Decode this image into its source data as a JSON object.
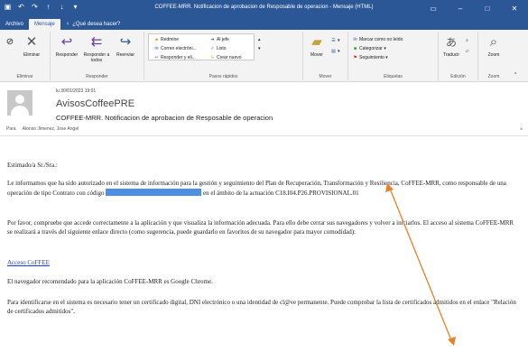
{
  "window": {
    "title": "COFFEE-MRR. Notificacion de aprobacion de Resposable de operacion - Mensaje (HTML)"
  },
  "tabs": [
    "Archivo",
    "Mensaje",
    "¿Qué desea hacer?"
  ],
  "ribbon": {
    "delete_group": {
      "ignore": "",
      "delete": "Eliminar",
      "label": "Eliminar"
    },
    "respond_group": {
      "reply": "Responder",
      "reply_all": "Responder a todos",
      "forward": "Reenviar",
      "label": "Responder"
    },
    "quicksteps_group": {
      "items": [
        "Redmine",
        "Correo electróni...",
        "Responder y eli...",
        "Al jefe",
        "Listo",
        "Crear nuevo"
      ],
      "label": "Pasos rápidos"
    },
    "move_group": {
      "move": "Mover",
      "label": "Mover"
    },
    "tags_group": {
      "mark_unread": "Marcar como no leído",
      "categorize": "Categorizar",
      "followup": "Seguimiento",
      "label": "Etiquetas"
    },
    "edit_group": {
      "translate": "Traducir",
      "label": "Edición"
    },
    "zoom_group": {
      "zoom": "Zoom",
      "label": "Zoom"
    }
  },
  "message": {
    "date": "lu 30/01/2023 19:01",
    "sender": "AvisosCoffeePRE",
    "subject": "COFFEE-MRR. Notificacion de aprobacion de Resposable de operacion",
    "to_label": "Para",
    "to": "Alonso Jimenez, Jose Angel"
  },
  "body": {
    "greeting": "Estimado/a Sr./Sra.:",
    "p1_a": "Le informamos que ha sido autorizado en el sistema de información para la gestión y seguimiento del Plan de Recuperación, Transformación y Resiliencia, CoFFEE-MRR, como responsable de una operación de tipo Contrato con código",
    "p1_b": "en el ámbito de la actuación C18.I04.P26.PROVISIONAL.01",
    "p2": "Por favor, compruebe que accede correctamente a la aplicación y que visualiza la información adecuada. Para ello debe cerrar sus navegadores y volver a iniciarlos. El acceso al sistema CoFFEE-MRR se realizará a través del siguiente enlace directo (como sugerencia, puede guardarlo en favoritos de su navegador para mayor comodidad):",
    "link": "Acceso CoFFEE",
    "p3": "El navegador recomendado para la aplicación CoFFEE-MRR es Google Chrome.",
    "p4": "Para identificarse en el sistema es necesario tener un certificado digital, DNI electrónico o una identidad de cl@ve permanente. Puede comprobar la lista de certificados admitidos en el enlace \"Relación de certificados admitidos\"."
  },
  "colors": {
    "titlebar": "#2b5797",
    "link": "#1a3fd6",
    "redaction": "#4d8fe0",
    "arrow": "#e8802a"
  }
}
